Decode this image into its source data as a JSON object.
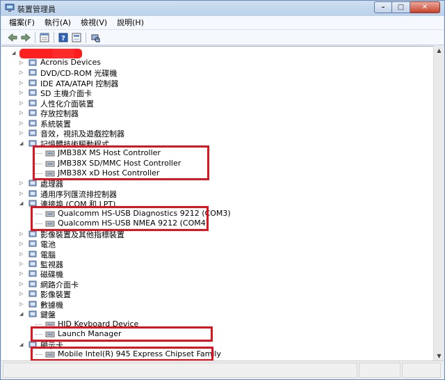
{
  "window": {
    "title": "裝置管理員",
    "caption": {
      "minimize": "–",
      "maximize": "□",
      "close": "✕"
    }
  },
  "menu": [
    "檔案(F)",
    "執行(A)",
    "檢視(V)",
    "說明(H)"
  ],
  "toolbar": {
    "buttons": [
      "back-icon",
      "forward-icon",
      "properties-icon",
      "help-icon",
      "view-icon",
      "scan-icon"
    ]
  },
  "tree": {
    "root_redacted": true,
    "items": [
      {
        "label": "Acronis Devices",
        "level": 1,
        "state": "collapsed"
      },
      {
        "label": "DVD/CD-ROM 光碟機",
        "level": 1,
        "state": "collapsed"
      },
      {
        "label": "IDE ATA/ATAPI 控制器",
        "level": 1,
        "state": "collapsed"
      },
      {
        "label": "SD 主機介面卡",
        "level": 1,
        "state": "collapsed"
      },
      {
        "label": "人性化介面裝置",
        "level": 1,
        "state": "collapsed"
      },
      {
        "label": "存放控制器",
        "level": 1,
        "state": "collapsed"
      },
      {
        "label": "系統裝置",
        "level": 1,
        "state": "collapsed"
      },
      {
        "label": "音效，視訊及遊戲控制器",
        "level": 1,
        "state": "collapsed"
      },
      {
        "label": "記憶體技術驅動程式",
        "level": 1,
        "state": "expanded"
      },
      {
        "label": "JMB38X MS Host Controller",
        "level": 2,
        "state": "leaf"
      },
      {
        "label": "JMB38X SD/MMC Host Controller",
        "level": 2,
        "state": "leaf"
      },
      {
        "label": "JMB38X xD Host Controller",
        "level": 2,
        "state": "leaf"
      },
      {
        "label": "處理器",
        "level": 1,
        "state": "collapsed"
      },
      {
        "label": "通用序列匯流排控制器",
        "level": 1,
        "state": "collapsed"
      },
      {
        "label": "連接埠 (COM 和 LPT)",
        "level": 1,
        "state": "expanded"
      },
      {
        "label": "Qualcomm HS-USB Diagnostics 9212 (COM3)",
        "level": 2,
        "state": "leaf"
      },
      {
        "label": "Qualcomm HS-USB NMEA 9212 (COM4)",
        "level": 2,
        "state": "leaf"
      },
      {
        "label": "影像裝置及其他指標裝置",
        "level": 1,
        "state": "collapsed"
      },
      {
        "label": "電池",
        "level": 1,
        "state": "collapsed"
      },
      {
        "label": "電腦",
        "level": 1,
        "state": "collapsed"
      },
      {
        "label": "監視器",
        "level": 1,
        "state": "collapsed"
      },
      {
        "label": "磁碟機",
        "level": 1,
        "state": "collapsed"
      },
      {
        "label": "網路介面卡",
        "level": 1,
        "state": "collapsed"
      },
      {
        "label": "影像裝置",
        "level": 1,
        "state": "collapsed"
      },
      {
        "label": "數據機",
        "level": 1,
        "state": "collapsed"
      },
      {
        "label": "鍵盤",
        "level": 1,
        "state": "expanded"
      },
      {
        "label": "HID Keyboard Device",
        "level": 2,
        "state": "leaf"
      },
      {
        "label": "Launch Manager",
        "level": 2,
        "state": "leaf"
      },
      {
        "label": "顯示卡",
        "level": 1,
        "state": "expanded"
      },
      {
        "label": "Mobile Intel(R) 945 Express Chipset Family",
        "level": 2,
        "state": "leaf"
      }
    ]
  },
  "colors": {
    "highlight": "#e0141e",
    "redaction": "#ff3a3a"
  }
}
